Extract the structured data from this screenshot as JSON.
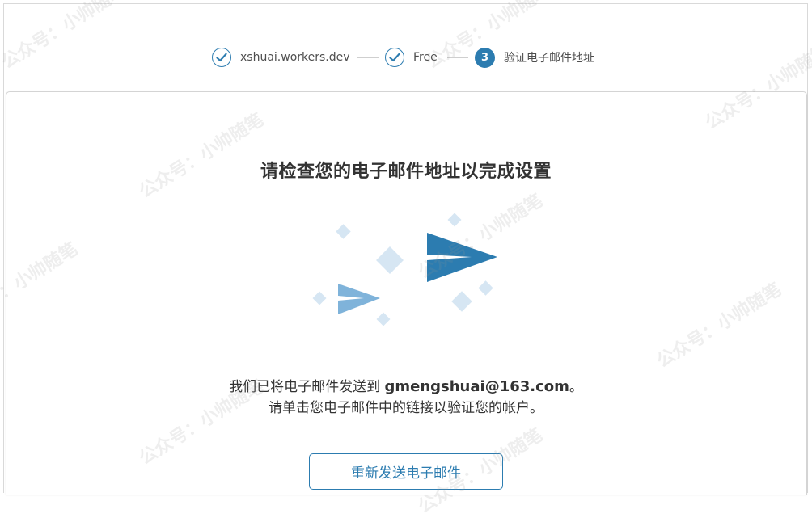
{
  "stepper": {
    "steps": [
      {
        "label": "xshuai.workers.dev",
        "state": "done"
      },
      {
        "label": "Free",
        "state": "done"
      },
      {
        "number": "3",
        "label": "验证电子邮件地址",
        "state": "active"
      }
    ]
  },
  "main": {
    "heading": "请检查您的电子邮件地址以完成设置",
    "message_prefix": "我们已将电子邮件发送到 ",
    "email": "gmengshuai@163.com",
    "message_suffix": "。",
    "message_line2": "请单击您电子邮件中的链接以验证您的帐户。",
    "resend_label": "重新发送电子邮件"
  },
  "watermark": {
    "text": "公众号：小帅随笔"
  },
  "colors": {
    "accent": "#2c7cb0",
    "plane_light": "#7fb3da",
    "diamond": "#d6e6f3",
    "text": "#333333",
    "border": "#d4d4d4"
  }
}
